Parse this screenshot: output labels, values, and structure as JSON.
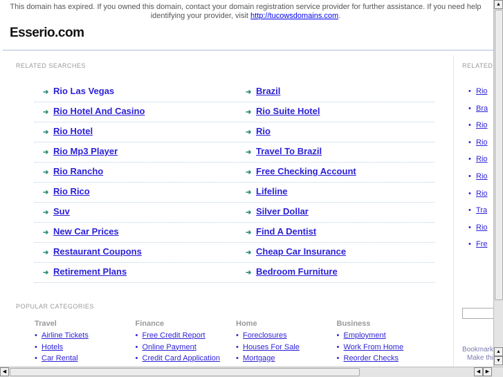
{
  "notice": {
    "text": "This domain has expired. If you owned this domain, contact your domain registration service provider for further assistance. If you need help identifying your provider, visit ",
    "link": "http://tucowsdomains.com",
    "end": "."
  },
  "site_title": "Esserio.com",
  "related": {
    "heading": "RELATED SEARCHES",
    "left": [
      "Rio Las Vegas",
      "Rio Hotel And Casino",
      "Rio Hotel",
      "Rio Mp3 Player",
      "Rio Rancho",
      "Rio Rico",
      "Suv",
      "New Car Prices",
      "Restaurant Coupons",
      "Retirement Plans"
    ],
    "right": [
      "Brazil",
      "Rio Suite Hotel",
      "Rio",
      "Travel To Brazil",
      "Free Checking Account",
      "Lifeline",
      "Silver Dollar",
      "Find A Dentist",
      "Cheap Car Insurance",
      "Bedroom Furniture"
    ]
  },
  "popular": {
    "heading": "POPULAR CATEGORIES",
    "cats": [
      {
        "title": "Travel",
        "items": [
          "Airline Tickets",
          "Hotels",
          "Car Rental"
        ]
      },
      {
        "title": "Finance",
        "items": [
          "Free Credit Report",
          "Online Payment",
          "Credit Card Application"
        ]
      },
      {
        "title": "Home",
        "items": [
          "Foreclosures",
          "Houses For Sale",
          "Mortgage"
        ]
      },
      {
        "title": "Business",
        "items": [
          "Employment",
          "Work From Home",
          "Reorder Checks"
        ]
      }
    ]
  },
  "sidebar": {
    "heading": "RELATED",
    "items": [
      "Rio",
      "Bra",
      "Rio",
      "Rio",
      "Rio",
      "Rio",
      "Rio",
      "Tra",
      "Rio",
      "Fre"
    ],
    "bookmark": "Bookmark",
    "make": "Make thi"
  },
  "colors": {
    "link": "#2b1fd6",
    "arrow": "#2e8a7a",
    "divider": "#a9bcd8"
  }
}
